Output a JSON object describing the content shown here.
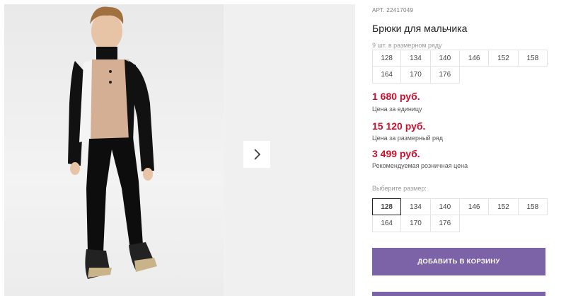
{
  "product": {
    "article_label": "АРТ.",
    "article_number": "22417049",
    "title": "Брюки для мальчика",
    "pack_note": "9 шт. в размерном ряду"
  },
  "pack_sizes": [
    "128",
    "134",
    "140",
    "146",
    "152",
    "158",
    "164",
    "170",
    "176"
  ],
  "prices": {
    "unit_price": "1 680 руб.",
    "unit_label": "Цена за единицу",
    "pack_price": "15 120 руб.",
    "pack_label": "Цена за размерный ряд",
    "retail_price": "3 499 руб.",
    "retail_label": "Рекомендуемая розничная цена"
  },
  "size_picker": {
    "label": "Выберите размер:",
    "options": [
      "128",
      "134",
      "140",
      "146",
      "152",
      "158",
      "164",
      "170",
      "176"
    ],
    "selected": "128"
  },
  "actions": {
    "add_to_cart": "ДОБАВИТЬ В КОРЗИНУ"
  },
  "gallery": {
    "next_icon": "chevron-right-icon"
  },
  "colors": {
    "accent": "#7c63a7",
    "price": "#c8102e"
  }
}
